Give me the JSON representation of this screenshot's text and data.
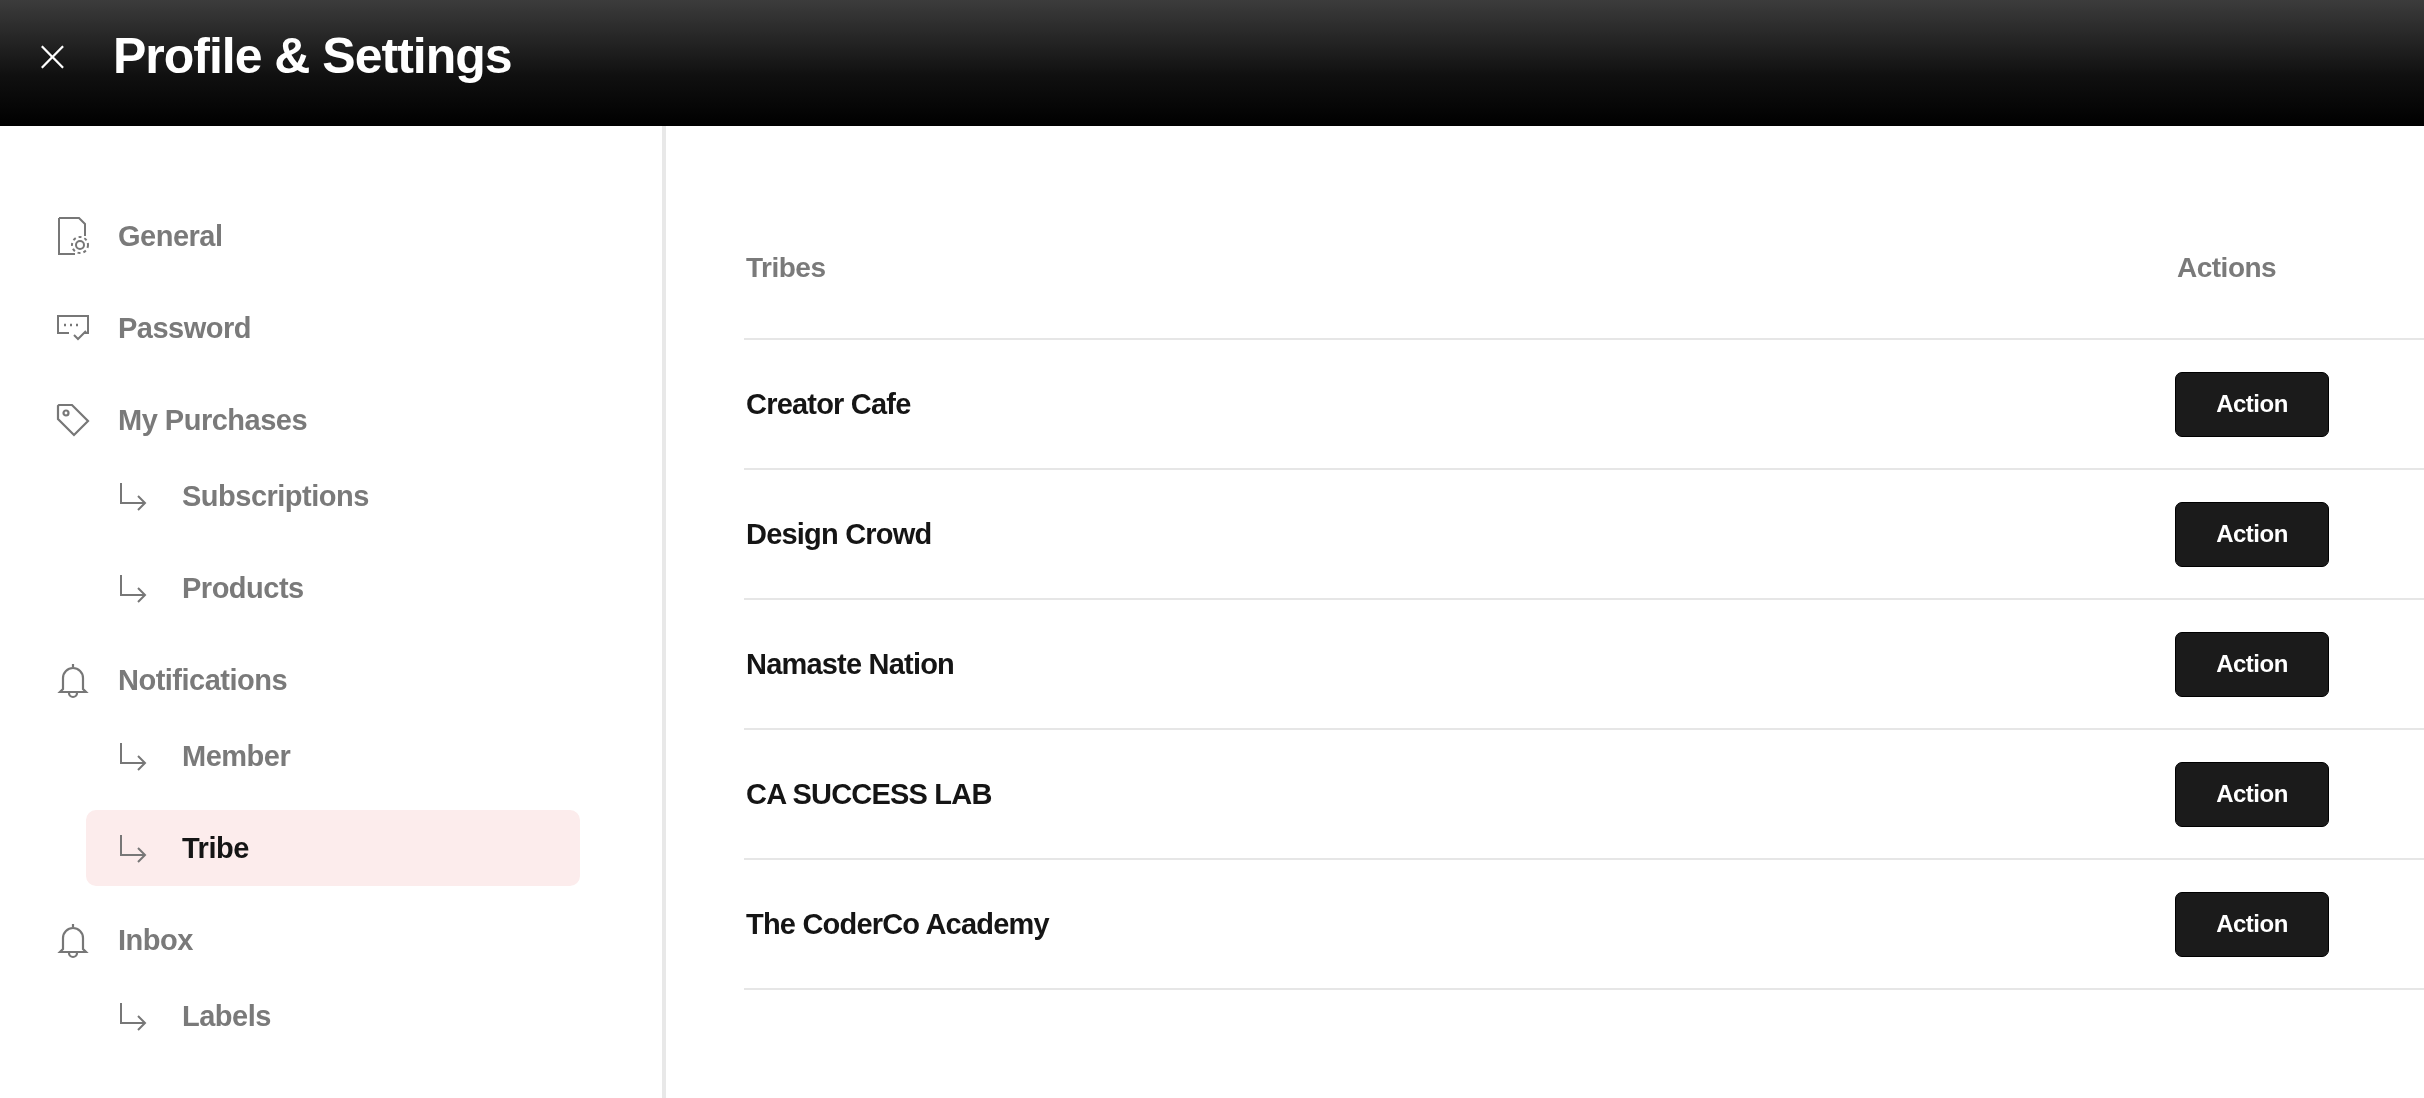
{
  "header": {
    "close_icon": "×",
    "title": "Profile & Settings"
  },
  "sidebar": {
    "items": [
      {
        "label": "General",
        "selected": false
      },
      {
        "label": "Password",
        "selected": false
      },
      {
        "label": "My Purchases",
        "selected": false,
        "children": [
          {
            "label": "Subscriptions",
            "selected": false
          },
          {
            "label": "Products",
            "selected": false
          }
        ]
      },
      {
        "label": "Notifications",
        "selected": false,
        "children": [
          {
            "label": "Member",
            "selected": false
          },
          {
            "label": "Tribe",
            "selected": true
          }
        ]
      },
      {
        "label": "Inbox",
        "selected": false,
        "children": [
          {
            "label": "Labels",
            "selected": false
          }
        ]
      }
    ]
  },
  "table": {
    "columns": [
      "Tribes",
      "Actions"
    ],
    "rows": [
      {
        "name": "Creator Cafe",
        "action": "Action"
      },
      {
        "name": "Design Crowd",
        "action": "Action"
      },
      {
        "name": "Namaste Nation",
        "action": "Action"
      },
      {
        "name": "CA SUCCESS LAB",
        "action": "Action"
      },
      {
        "name": "The CoderCo Academy",
        "action": "Action"
      }
    ]
  }
}
